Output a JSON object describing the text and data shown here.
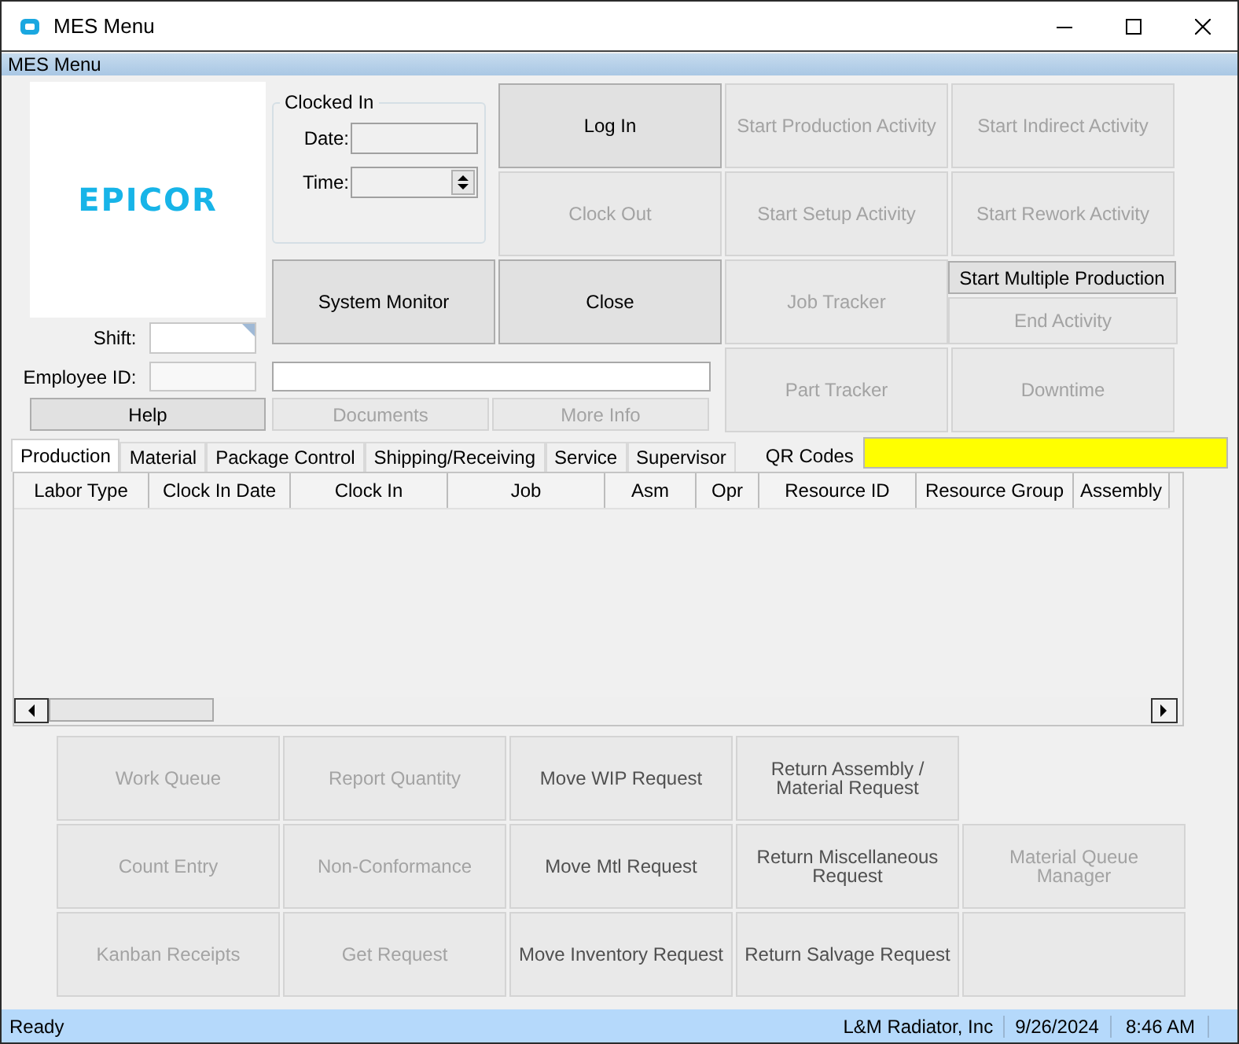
{
  "window": {
    "title": "MES Menu"
  },
  "menu_strip": {
    "title": "MES Menu"
  },
  "logo": {
    "text": "EPICOR"
  },
  "employee": {
    "shift_label": "Shift:",
    "employee_id_label": "Employee ID:",
    "help_button": "Help"
  },
  "clocked_in": {
    "title": "Clocked In",
    "date_label": "Date:",
    "time_label": "Time:"
  },
  "action_buttons": [
    {
      "label": "Log In",
      "disabled": false
    },
    {
      "label": "Start Production Activity",
      "disabled": true
    },
    {
      "label": "Start Indirect Activity",
      "disabled": true
    },
    {
      "label": "Clock Out",
      "disabled": true
    },
    {
      "label": "Start Setup Activity",
      "disabled": true
    },
    {
      "label": "Start Rework Activity",
      "disabled": true
    },
    {
      "label": "System Monitor",
      "disabled": false
    },
    {
      "label": "Close",
      "disabled": false
    },
    {
      "label": "Job Tracker",
      "disabled": true
    },
    {
      "label": "Start Multiple Production",
      "disabled": false
    },
    {
      "label": "End Activity",
      "disabled": true
    },
    {
      "label": "Part Tracker",
      "disabled": true
    },
    {
      "label": "Downtime",
      "disabled": true
    }
  ],
  "info_buttons": [
    {
      "label": "Documents",
      "disabled": true
    },
    {
      "label": "More Info",
      "disabled": true
    }
  ],
  "tabs": [
    {
      "label": "Production",
      "selected": true
    },
    {
      "label": "Material",
      "selected": false
    },
    {
      "label": "Package Control",
      "selected": false
    },
    {
      "label": "Shipping/Receiving",
      "selected": false
    },
    {
      "label": "Service",
      "selected": false
    },
    {
      "label": "Supervisor",
      "selected": false
    }
  ],
  "qr_codes": {
    "label": "QR Codes"
  },
  "table": {
    "columns": [
      "Labor Type",
      "Clock In Date",
      "Clock In",
      "Job",
      "Asm",
      "Opr",
      "Resource ID",
      "Resource Group",
      "Assembly"
    ]
  },
  "task_buttons": [
    {
      "label": "Work Queue",
      "disabled": true
    },
    {
      "label": "Report Quantity",
      "disabled": true
    },
    {
      "label": "Move WIP Request",
      "disabled": false
    },
    {
      "label": "Return Assembly / Material Request",
      "disabled": false
    },
    {
      "label": "Count Entry",
      "disabled": true
    },
    {
      "label": "Non-Conformance",
      "disabled": true
    },
    {
      "label": "Move Mtl Request",
      "disabled": false
    },
    {
      "label": "Return Miscellaneous Request",
      "disabled": false
    },
    {
      "label": "Material Queue Manager",
      "disabled": true
    },
    {
      "label": "Kanban Receipts",
      "disabled": true
    },
    {
      "label": "Get Request",
      "disabled": true
    },
    {
      "label": "Move Inventory Request",
      "disabled": false
    },
    {
      "label": "Return Salvage Request",
      "disabled": false
    }
  ],
  "status_bar": {
    "status": "Ready",
    "company": "L&M Radiator, Inc",
    "date": "9/26/2024",
    "time": "8:46 AM"
  }
}
